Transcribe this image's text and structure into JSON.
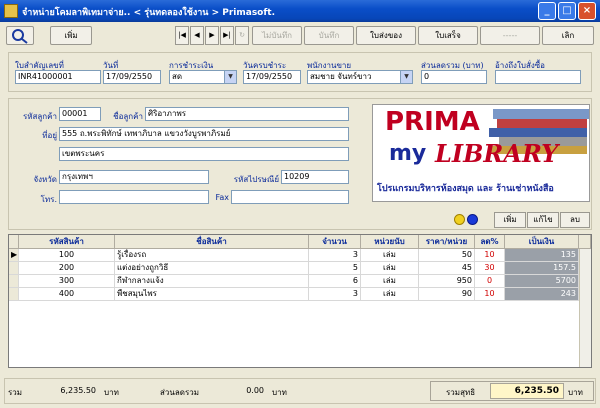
{
  "window": {
    "title": "จำหน่ายโคมลาพิเทมาจ่าย.. < รุ่นทดลองใช้งาน > Primasoft."
  },
  "toolbar": {
    "add_label": "เพิ่ม",
    "save_cancel_label": "ไม่บันทึก",
    "save_label": "บันทึก",
    "print_delivery_label": "ใบส่งของ",
    "print_receipt_label": "ใบเสร็จ",
    "blank_label": "-----",
    "exit_label": "เลิก"
  },
  "header": {
    "invoice_no_label": "ใบสำคัญเลขที่",
    "invoice_no": "INR41000001",
    "date_label": "วันที่",
    "date": "17/09/2550",
    "payment_label": "การชำระเงิน",
    "payment": "สด",
    "due_label": "วันครบชำระ",
    "due": "17/09/2550",
    "salesperson_label": "พนักงานขาย",
    "salesperson": "สมชาย จันทร์ขาว",
    "discount_label": "ส่วนลดรวม (บาท)",
    "discount": "0",
    "ref_label": "อ้างถึงใบสั่งซื้อ",
    "ref": ""
  },
  "customer": {
    "code_label": "รหัสลูกค้า",
    "code": "00001",
    "name_label": "ชื่อลูกค้า",
    "name": "ศิริอาภาพร",
    "address_label": "ที่อยู่",
    "address1": "555 ถ.พระพิทักษ์ เทพาภิบาล แขวงวังบูรพาภิรมย์",
    "address2": "เขตพระนคร",
    "province_label": "จังหวัด",
    "province": "กรุงเทพฯ",
    "zip_label": "รหัสไปรษณีย์",
    "zip": "10209",
    "phone_label": "โทร.",
    "phone": "",
    "fax_label": "Fax",
    "fax": ""
  },
  "logo": {
    "line1": "PRIMA",
    "line2a": "my",
    "line2b": "LIBRARY",
    "tagline": "โปรแกรมบริหารห้องสมุด และ ร้านเช่าหนังสือ"
  },
  "item_buttons": {
    "add": "เพิ่ม",
    "edit": "แก้ไข",
    "delete": "ลบ"
  },
  "grid": {
    "headers": [
      "รหัสสินค้า",
      "ชื่อสินค้า",
      "จำนวน",
      "หน่วยนับ",
      "ราคา/หน่วย",
      "ลด%",
      "เป็นเงิน"
    ],
    "rows": [
      [
        "100",
        "รู้เรื่องรถ",
        "3",
        "เล่ม",
        "50",
        "10",
        "135"
      ],
      [
        "200",
        "แต่งอย่างถูกวิธี",
        "5",
        "เล่ม",
        "45",
        "30",
        "157.5"
      ],
      [
        "300",
        "กีฬากลางแจ้ง",
        "6",
        "เล่ม",
        "950",
        "0",
        "5700"
      ],
      [
        "400",
        "พืชสมุนไพร",
        "3",
        "เล่ม",
        "90",
        "10",
        "243"
      ]
    ]
  },
  "totals": {
    "sum_label": "รวม",
    "sum": "6,235.50",
    "baht1": "บาท",
    "discount_label": "ส่วนลดรวม",
    "discount": "0.00",
    "baht2": "บาท",
    "net_label": "รวมสุทธิ",
    "net": "6,235.50",
    "baht3": "บาท"
  },
  "colors": {
    "titlebar": "#0a4ec8",
    "label": "#0a2a9a",
    "grey_cell": "#9aa0a8",
    "net_bg": "#fff6c8"
  }
}
